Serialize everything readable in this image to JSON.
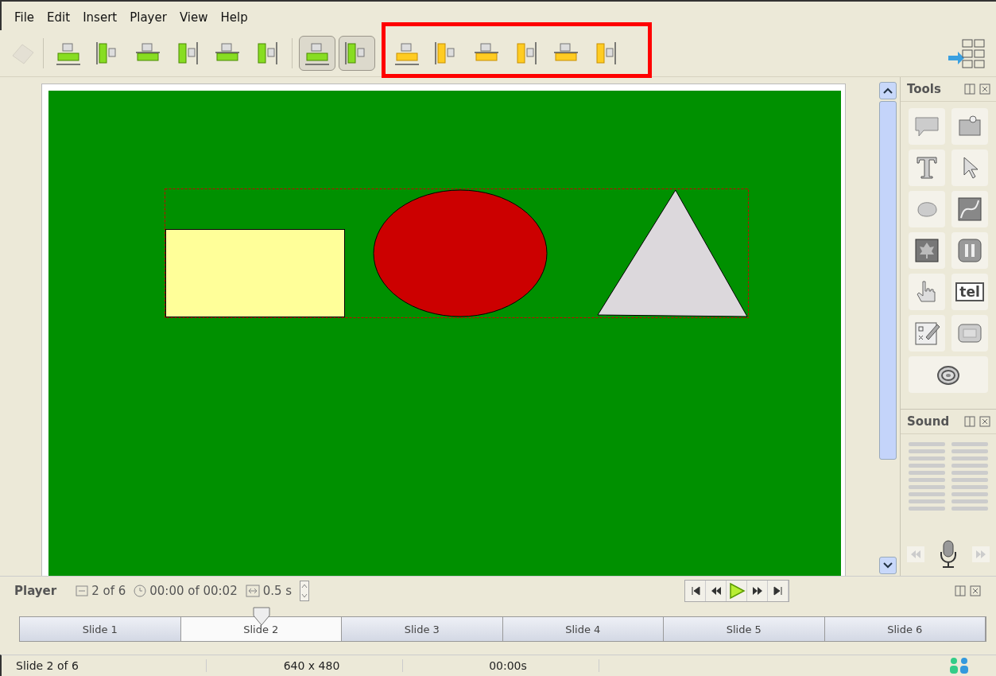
{
  "menu": [
    "File",
    "Edit",
    "Insert",
    "Player",
    "View",
    "Help"
  ],
  "toolbar": {
    "buttons": [
      {
        "kind": "green",
        "pressed": false
      },
      {
        "kind": "green",
        "pressed": false
      },
      {
        "kind": "green",
        "pressed": false
      },
      {
        "kind": "green",
        "pressed": false
      },
      {
        "kind": "green",
        "pressed": false
      },
      {
        "kind": "green",
        "pressed": false
      },
      {
        "kind": "green",
        "pressed": true
      },
      {
        "kind": "green",
        "pressed": true
      },
      {
        "kind": "yellow",
        "pressed": false
      },
      {
        "kind": "yellow",
        "pressed": false
      },
      {
        "kind": "yellow",
        "pressed": false
      },
      {
        "kind": "yellow",
        "pressed": false
      },
      {
        "kind": "yellow",
        "pressed": false
      },
      {
        "kind": "yellow",
        "pressed": false
      }
    ],
    "highlighted": true
  },
  "slide": {
    "shapes": [
      {
        "kind": "rectangle",
        "color": "#ffff99"
      },
      {
        "kind": "ellipse",
        "color": "#cc0000"
      },
      {
        "kind": "triangle",
        "color": "#dcd8dc"
      }
    ],
    "selection": true
  },
  "tools": {
    "title": "Tools",
    "items": [
      {
        "kind": "callout"
      },
      {
        "kind": "pin"
      },
      {
        "kind": "text"
      },
      {
        "kind": "pointer"
      },
      {
        "kind": "shape"
      },
      {
        "kind": "curve"
      },
      {
        "kind": "image"
      },
      {
        "kind": "pause"
      },
      {
        "kind": "hand"
      },
      {
        "kind": "text-field",
        "glyph": "tel"
      },
      {
        "kind": "quiz"
      },
      {
        "kind": "button"
      },
      {
        "kind": "spiral"
      }
    ]
  },
  "sound": {
    "title": "Sound"
  },
  "player": {
    "title": "Player",
    "slide_count": "2 of 6",
    "time": "00:00 of 00:02",
    "delay": "0.5 s"
  },
  "slides": [
    {
      "label": "Slide 1",
      "selected": false
    },
    {
      "label": "Slide 2",
      "selected": true
    },
    {
      "label": "Slide 3",
      "selected": false
    },
    {
      "label": "Slide 4",
      "selected": false
    },
    {
      "label": "Slide 5",
      "selected": false
    },
    {
      "label": "Slide 6",
      "selected": false
    }
  ],
  "status_bar": [
    "Slide 2 of 6",
    "640 x 480",
    "00:00s"
  ]
}
